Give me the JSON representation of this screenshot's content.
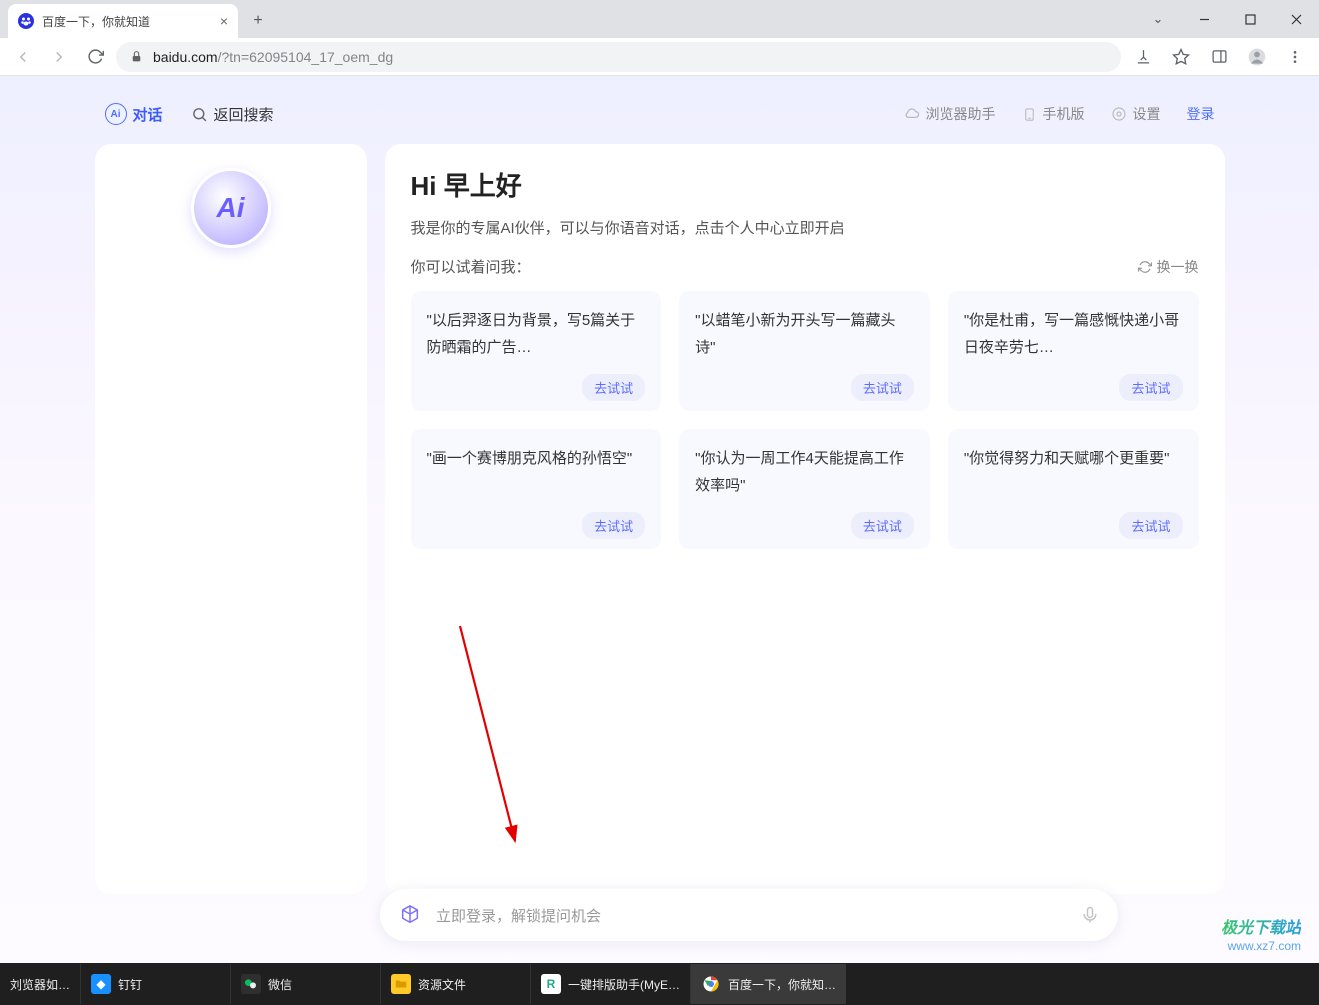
{
  "browser": {
    "tab_title": "百度一下，你就知道",
    "new_tab": "+",
    "url_domain": "baidu.com",
    "url_path": "/?tn=62095104_17_oem_dg"
  },
  "topnav": {
    "chat": "对话",
    "back_search": "返回搜索",
    "browser_helper": "浏览器助手",
    "mobile": "手机版",
    "settings": "设置",
    "login": "登录"
  },
  "ai_badge": "Ai",
  "greeting": "Hi 早上好",
  "sub_greeting": "我是你的专属AI伙伴，可以与你语音对话，点击个人中心立即开启",
  "try_label": "你可以试着问我：",
  "refresh_label": "换一换",
  "try_button": "去试试",
  "prompts": [
    "\"以后羿逐日为背景，写5篇关于防晒霜的广告…",
    "\"以蜡笔小新为开头写一篇藏头诗\"",
    "\"你是杜甫，写一篇感慨快递小哥日夜辛劳七…",
    "\"画一个赛博朋克风格的孙悟空\"",
    "\"你认为一周工作4天能提高工作效率吗\"",
    "\"你觉得努力和天赋哪个更重要\""
  ],
  "input_placeholder": "立即登录，解锁提问机会",
  "watermark": {
    "line1": "极光下载站",
    "line2": "www.xz7.com"
  },
  "taskbar": {
    "items": [
      "刘览器如…",
      "钉钉",
      "微信",
      "资源文件",
      "一键排版助手(MyE…",
      "百度一下，你就知…"
    ]
  }
}
